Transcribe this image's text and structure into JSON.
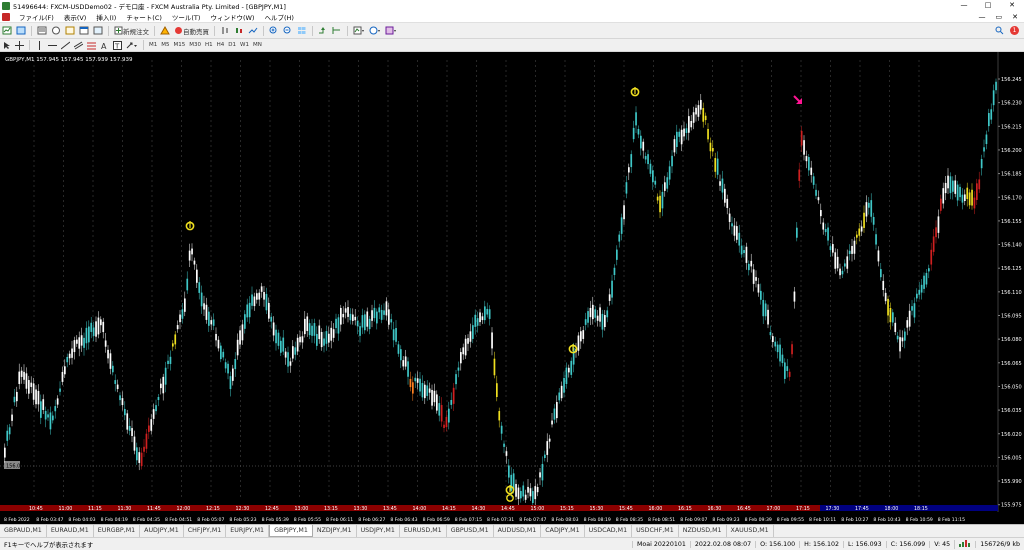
{
  "window": {
    "title": "51496644: FXCM-USDDemo02 - デモ口座 - FXCM Australia Pty. Limited - [GBPJPY,M1]",
    "buttons": [
      "—",
      "□",
      "✕"
    ]
  },
  "menu": {
    "items": [
      "ファイル(F)",
      "表示(V)",
      "挿入(I)",
      "チャート(C)",
      "ツール(T)",
      "ウィンドウ(W)",
      "ヘルプ(H)"
    ],
    "right": [
      "—",
      "▭",
      "✕"
    ]
  },
  "toolbar": {
    "new_order": "新規注文",
    "auto_trade": "自動売買",
    "timeframes": [
      "M1",
      "M5",
      "M15",
      "M30",
      "H1",
      "H4",
      "D1",
      "W1",
      "MN"
    ],
    "notification_count": "1"
  },
  "chart": {
    "info": "GBPJPY,M1  157.945 157.945 157.939 157.939",
    "price_labels": [
      "156.245",
      "156.230",
      "156.215",
      "156.200",
      "156.185",
      "156.170",
      "156.155",
      "156.140",
      "156.125",
      "156.110",
      "156.095",
      "156.080",
      "156.065",
      "156.050",
      "156.035",
      "156.020",
      "156.005",
      "155.990",
      "155.975"
    ],
    "current_price": "156.0",
    "session_labels": [
      "10:45",
      "11:00",
      "11:15",
      "11:30",
      "11:45",
      "12:00",
      "12:15",
      "12:30",
      "12:45",
      "13:00",
      "13:15",
      "13:30",
      "13:45",
      "14:00",
      "14:15",
      "14:30",
      "14:45",
      "15:00",
      "15:15",
      "15:30",
      "15:45",
      "16:00",
      "16:15",
      "16:30",
      "16:45",
      "17:00",
      "17:15",
      "17:30",
      "17:45",
      "18:00",
      "18:15"
    ],
    "time_labels": [
      "8 Feb 2022",
      "8 Feb 03:47",
      "8 Feb 04:03",
      "8 Feb 04:19",
      "8 Feb 04:35",
      "8 Feb 04:51",
      "8 Feb 05:07",
      "8 Feb 05:23",
      "8 Feb 05:39",
      "8 Feb 05:55",
      "8 Feb 06:11",
      "8 Feb 06:27",
      "8 Feb 06:43",
      "8 Feb 06:59",
      "8 Feb 07:15",
      "8 Feb 07:31",
      "8 Feb 07:47",
      "8 Feb 08:03",
      "8 Feb 08:19",
      "8 Feb 08:35",
      "8 Feb 08:51",
      "8 Feb 09:07",
      "8 Feb 09:23",
      "8 Feb 09:39",
      "8 Feb 09:55",
      "8 Feb 10:11",
      "8 Feb 10:27",
      "8 Feb 10:43",
      "8 Feb 10:59",
      "8 Feb 11:15"
    ],
    "colors": {
      "background": "#000000",
      "bull": "#3fc8c8",
      "bear": "#ffffff",
      "alert_yellow": "#f0e020",
      "alert_red": "#d02020",
      "alert_orange": "#ff8020",
      "marker": "#f0e020",
      "arrow": "#ff1493",
      "session_bar_red": "#8b0000",
      "session_bar_blue": "#000080"
    }
  },
  "tabs": [
    "GBPAUD,M1",
    "EURAUD,M1",
    "EURGBP,M1",
    "AUDJPY,M1",
    "CHFJPY,M1",
    "EURJPY,M1",
    "GBPJPY,M1",
    "NZDJPY,M1",
    "USDJPY,M1",
    "EURUSD,M1",
    "GBPUSD,M1",
    "AUDUSD,M1",
    "CADJPY,M1",
    "USDCAD,M1",
    "USDCHF,M1",
    "NZDUSD,M1",
    "XAUUSD,M1"
  ],
  "active_tab": "GBPJPY,M1",
  "status": {
    "help": "F1キーでヘルプが表示されます",
    "profile": "Moai 20220101",
    "datetime": "2022.02.08 08:07",
    "open": "O: 156.100",
    "high": "H: 156.102",
    "low": "L: 156.093",
    "close": "C: 156.099",
    "volume": "V: 45",
    "traffic": "156726/9 kb"
  }
}
